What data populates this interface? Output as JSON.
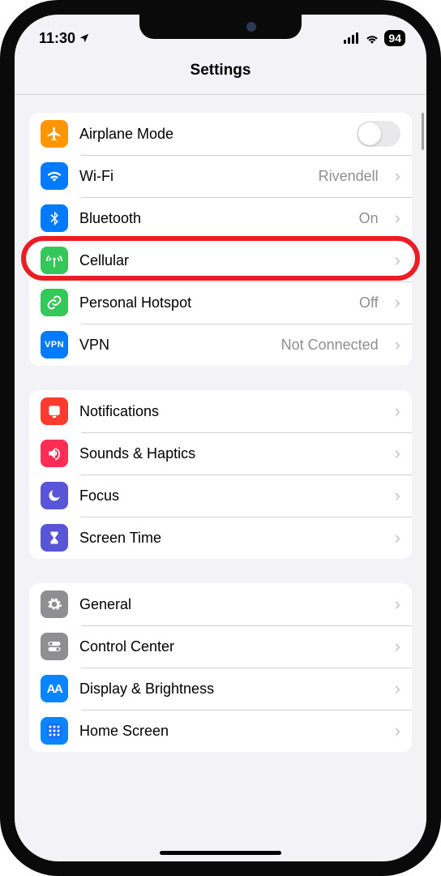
{
  "status": {
    "time": "11:30",
    "battery": "94"
  },
  "header": {
    "title": "Settings"
  },
  "groups": [
    {
      "rows": [
        {
          "id": "airplane",
          "label": "Airplane Mode",
          "detail": "",
          "control": "toggle",
          "color": "bg-orange",
          "icon": "airplane"
        },
        {
          "id": "wifi",
          "label": "Wi-Fi",
          "detail": "Rivendell",
          "control": "chevron",
          "color": "bg-blue",
          "icon": "wifi"
        },
        {
          "id": "bluetooth",
          "label": "Bluetooth",
          "detail": "On",
          "control": "chevron",
          "color": "bg-blue",
          "icon": "bluetooth"
        },
        {
          "id": "cellular",
          "label": "Cellular",
          "detail": "",
          "control": "chevron",
          "color": "bg-green",
          "icon": "antenna",
          "highlight": true
        },
        {
          "id": "hotspot",
          "label": "Personal Hotspot",
          "detail": "Off",
          "control": "chevron",
          "color": "bg-green",
          "icon": "link"
        },
        {
          "id": "vpn",
          "label": "VPN",
          "detail": "Not Connected",
          "control": "chevron",
          "color": "bg-vpn",
          "icon": "vpn"
        }
      ]
    },
    {
      "rows": [
        {
          "id": "notifications",
          "label": "Notifications",
          "detail": "",
          "control": "chevron",
          "color": "bg-red",
          "icon": "bell"
        },
        {
          "id": "sounds",
          "label": "Sounds & Haptics",
          "detail": "",
          "control": "chevron",
          "color": "bg-rose",
          "icon": "speaker"
        },
        {
          "id": "focus",
          "label": "Focus",
          "detail": "",
          "control": "chevron",
          "color": "bg-indigo",
          "icon": "moon"
        },
        {
          "id": "screentime",
          "label": "Screen Time",
          "detail": "",
          "control": "chevron",
          "color": "bg-indigo",
          "icon": "hourglass"
        }
      ]
    },
    {
      "rows": [
        {
          "id": "general",
          "label": "General",
          "detail": "",
          "control": "chevron",
          "color": "bg-gray",
          "icon": "gear"
        },
        {
          "id": "control",
          "label": "Control Center",
          "detail": "",
          "control": "chevron",
          "color": "bg-gray",
          "icon": "switches"
        },
        {
          "id": "display",
          "label": "Display & Brightness",
          "detail": "",
          "control": "chevron",
          "color": "bg-bluea",
          "icon": "aa"
        },
        {
          "id": "homescreen",
          "label": "Home Screen",
          "detail": "",
          "control": "chevron",
          "color": "bg-bluea",
          "icon": "grid"
        }
      ]
    }
  ]
}
